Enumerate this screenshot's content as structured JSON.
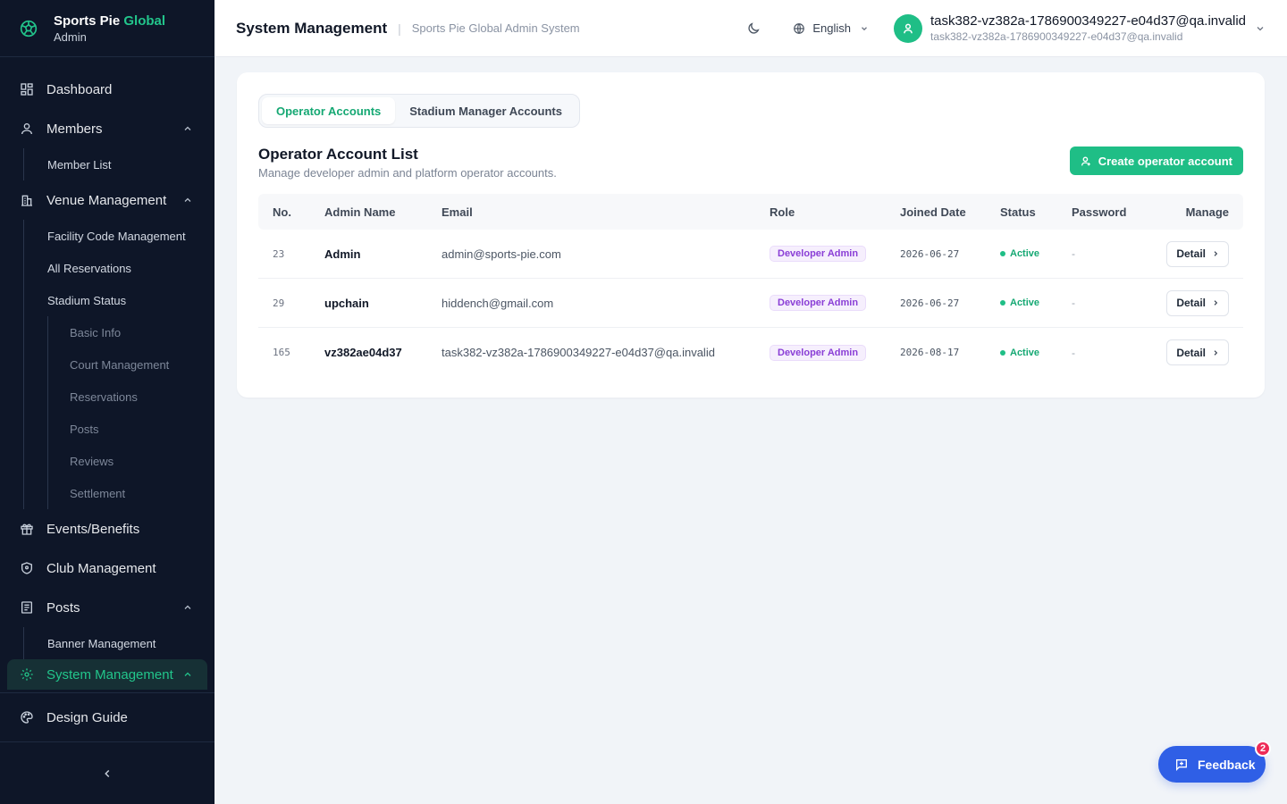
{
  "brand": {
    "name_main": "Sports Pie",
    "name_accent": "Global",
    "subtitle": "Admin",
    "accent_color": "#22c58b"
  },
  "sidebar": {
    "dashboard": "Dashboard",
    "members": "Members",
    "member_list": "Member List",
    "venue_management": "Venue Management",
    "facility_code": "Facility Code Management",
    "all_reservations": "All Reservations",
    "stadium_status": "Stadium Status",
    "basic_info": "Basic Info",
    "court_management": "Court Management",
    "reservations": "Reservations",
    "posts_sub": "Posts",
    "reviews": "Reviews",
    "settlement": "Settlement",
    "events_benefits": "Events/Benefits",
    "club_management": "Club Management",
    "posts": "Posts",
    "banner_management": "Banner Management",
    "system_management": "System Management",
    "design_guide": "Design Guide"
  },
  "header": {
    "title": "System Management",
    "separator": "|",
    "subtitle": "Sports Pie Global Admin System",
    "language": "English",
    "user_name": "task382-vz382a-1786900349227-e04d37@qa.invalid",
    "user_email": "task382-vz382a-1786900349227-e04d37@qa.invalid"
  },
  "tabs": {
    "operator": "Operator Accounts",
    "stadium_manager": "Stadium Manager Accounts"
  },
  "list": {
    "title": "Operator Account List",
    "description": "Manage developer admin and platform operator accounts.",
    "create_button": "Create operator account"
  },
  "table": {
    "headers": {
      "no": "No.",
      "name": "Admin Name",
      "email": "Email",
      "role": "Role",
      "joined": "Joined Date",
      "status": "Status",
      "password": "Password",
      "manage": "Manage"
    },
    "rows": [
      {
        "no": "23",
        "name": "Admin",
        "email": "admin@sports-pie.com",
        "role": "Developer Admin",
        "joined": "2026-06-27",
        "status": "Active",
        "password": "-",
        "action": "Detail"
      },
      {
        "no": "29",
        "name": "upchain",
        "email": "hiddench@gmail.com",
        "role": "Developer Admin",
        "joined": "2026-06-27",
        "status": "Active",
        "password": "-",
        "action": "Detail"
      },
      {
        "no": "165",
        "name": "vz382ae04d37",
        "email": "task382-vz382a-1786900349227-e04d37@qa.invalid",
        "role": "Developer Admin",
        "joined": "2026-08-17",
        "status": "Active",
        "password": "-",
        "action": "Detail"
      }
    ]
  },
  "feedback": {
    "label": "Feedback",
    "count": "2"
  },
  "colors": {
    "primary": "#1fbe86",
    "sidebar_bg": "#0e1628",
    "feedback": "#2f5fe6",
    "badge": "#ee2b57",
    "role": "#8a3ed6"
  }
}
